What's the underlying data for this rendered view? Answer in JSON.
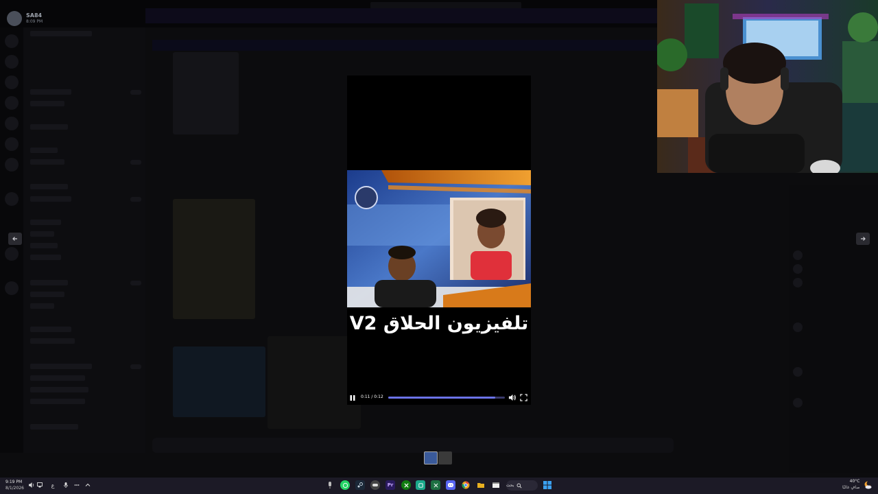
{
  "discord": {
    "user": {
      "name": "SA84",
      "time": "8:09 PM"
    }
  },
  "navigation": {
    "prev_arrow": "arrow-left-icon",
    "next_arrow": "arrow-right-icon"
  },
  "video": {
    "caption": "تلفيزيون الحلاق V2",
    "current_time": "0:11",
    "duration": "0:12",
    "time_display": "0:11 / 0:12",
    "progress": 0.92,
    "state": "playing",
    "accent_color": "#6b73e8"
  },
  "taskbar": {
    "left_clock": {
      "time": "9:19 PM",
      "date": "8/1/2026"
    },
    "language_indicator": "ع",
    "search_label": "بحث",
    "weather": {
      "temperature": "40°C",
      "condition": "صافٍ غالبًا"
    },
    "apps": [
      {
        "name": "mic",
        "icon": "microphone-icon"
      },
      {
        "name": "WhatsApp",
        "icon": "whatsapp-icon",
        "color": "#25d366"
      },
      {
        "name": "Steam",
        "icon": "steam-icon",
        "color": "#2a475e"
      },
      {
        "name": "Controller",
        "icon": "controller-icon",
        "color": "#555"
      },
      {
        "name": "Premiere Pro",
        "icon": "premiere-icon",
        "color": "#2a1a5e"
      },
      {
        "name": "Xbox",
        "icon": "xbox-icon",
        "color": "#107c10"
      },
      {
        "name": "Spotify/App",
        "icon": "app-green-icon",
        "color": "#1aa88a"
      },
      {
        "name": "Excel",
        "icon": "excel-icon",
        "color": "#1d6f42"
      },
      {
        "name": "Discord",
        "icon": "discord-icon",
        "color": "#5865f2"
      },
      {
        "name": "Chrome",
        "icon": "chrome-icon",
        "color": "#e8a020"
      },
      {
        "name": "File Explorer",
        "icon": "folder-icon",
        "color": "#e8b020"
      },
      {
        "name": "Window",
        "icon": "window-icon",
        "color": "#666"
      }
    ]
  }
}
